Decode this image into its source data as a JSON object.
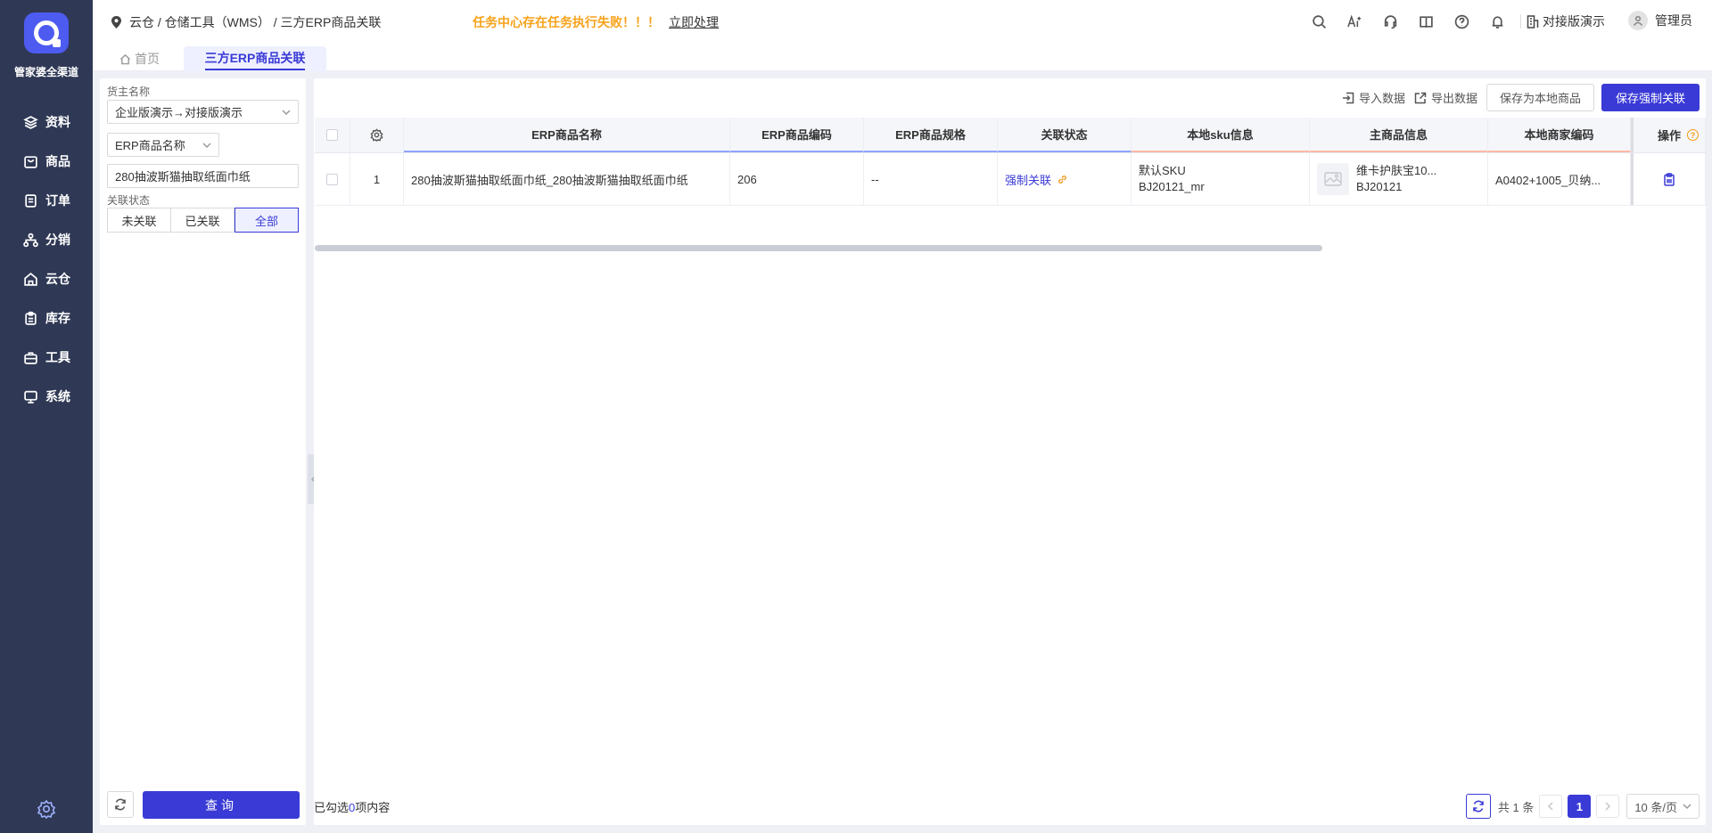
{
  "app": {
    "brand": "管家婆全渠道"
  },
  "nav": {
    "items": [
      {
        "label": "资料",
        "icon": "layers-icon"
      },
      {
        "label": "商品",
        "icon": "shopping-bag-icon"
      },
      {
        "label": "订单",
        "icon": "order-list-icon"
      },
      {
        "label": "分销",
        "icon": "hierarchy-icon"
      },
      {
        "label": "云仓",
        "icon": "cloud-warehouse-icon"
      },
      {
        "label": "库存",
        "icon": "clipboard-icon"
      },
      {
        "label": "工具",
        "icon": "toolbox-icon"
      },
      {
        "label": "系统",
        "icon": "monitor-icon"
      }
    ]
  },
  "header": {
    "breadcrumb": "云仓 / 仓储工具（WMS） / 三方ERP商品关联",
    "alert_text": "任务中心存在任务执行失败！！！",
    "alert_action": "立即处理",
    "env_label": "对接版演示",
    "user_name": "管理员"
  },
  "tabs": {
    "home": "首页",
    "active": "三方ERP商品关联"
  },
  "filter": {
    "owner_label": "货主名称",
    "owner_value": "企业版演示→对接版演示",
    "field_select": "ERP商品名称",
    "search_value": "280抽波斯猫抽取纸面巾纸",
    "status_label": "关联状态",
    "status_options": [
      "未关联",
      "已关联",
      "全部"
    ],
    "status_selected": "全部",
    "query_label": "查询"
  },
  "toolbar": {
    "import_label": "导入数据",
    "export_label": "导出数据",
    "save_local_label": "保存为本地商品",
    "save_force_label": "保存强制关联"
  },
  "table": {
    "columns": {
      "erp_name": "ERP商品名称",
      "erp_code": "ERP商品编码",
      "erp_spec": "ERP商品规格",
      "status": "关联状态",
      "sku": "本地sku信息",
      "main": "主商品信息",
      "merchant": "本地商家编码",
      "op": "操作"
    },
    "rows": [
      {
        "index": "1",
        "erp_name": "280抽波斯猫抽取纸面巾纸_280抽波斯猫抽取纸面巾纸",
        "erp_code": "206",
        "erp_spec": "--",
        "status": "强制关联",
        "sku_name": "默认SKU",
        "sku_code": "BJ20121_mr",
        "main_name": "维卡护肤宝10...",
        "main_code": "BJ20121",
        "merchant_code": "A0402+1005_贝纳..."
      }
    ]
  },
  "footer": {
    "selected_prefix": "已勾选",
    "selected_count": "0",
    "selected_suffix": "项内容",
    "total_text": "共 1 条",
    "current_page": "1",
    "page_size": "10 条/页"
  },
  "colors": {
    "sidebar_bg": "#2f3855",
    "primary": "#3a3ad6",
    "alert": "#f7a21b"
  }
}
